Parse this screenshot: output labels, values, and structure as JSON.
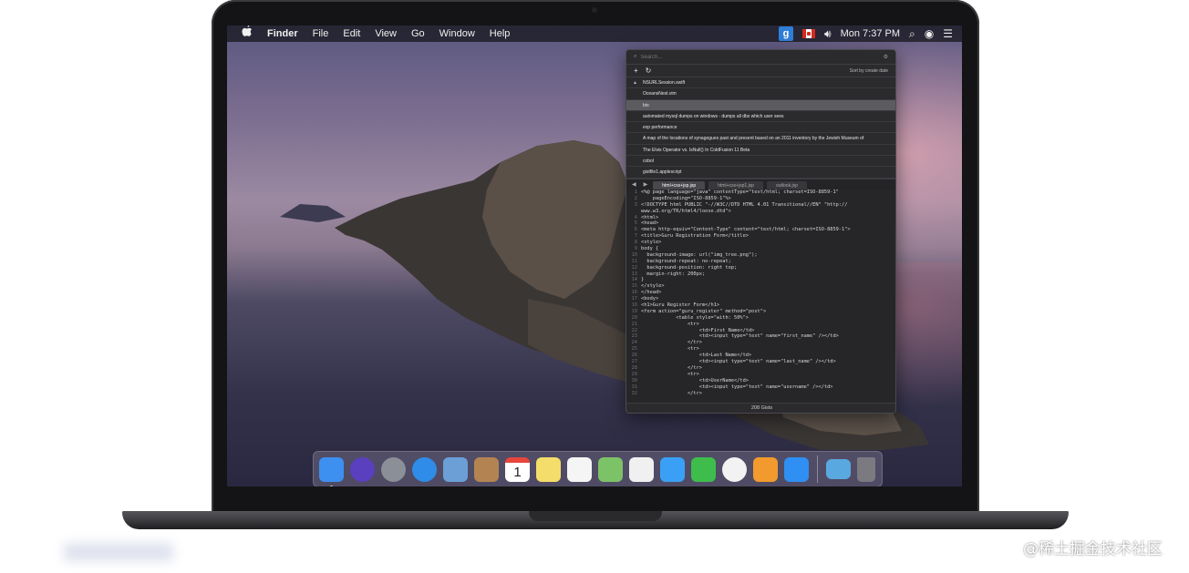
{
  "menubar": {
    "app_name": "Finder",
    "menus": [
      "File",
      "Edit",
      "View",
      "Go",
      "Window",
      "Help"
    ],
    "clock": "Mon 7:37 PM",
    "status_gist_letter": "g"
  },
  "popover": {
    "search_placeholder": "Search...",
    "sort_label": "Sort by create date",
    "add_symbol": "+",
    "refresh_symbol": "↻",
    "gists": [
      "NSURLSession.swift",
      "OceansNest.vim",
      "bio",
      "automated mysql dumps on windows - dumps all dbs which user sees",
      "exp performance",
      "A map of the locations of synagogues past and present based on an 2011 inventory by the Jewish Museum of",
      "The Elvis Operator vs. IsNull() In ColdFusion 11 Beta",
      "cobol",
      "gistfile1.applescript"
    ],
    "selected_index": 2,
    "tabs": [
      "html+css+jsp.jsp",
      "html+css+jsp1.jsp",
      "outlook.jsp"
    ],
    "active_tab": 0,
    "code_lines": [
      "<%@ page language=\"java\" contentType=\"text/html; charset=ISO-8859-1\"",
      "    pageEncoding=\"ISO-8859-1\"%>",
      "<!DOCTYPE html PUBLIC \"-//W3C//DTD HTML 4.01 Transitional//EN\" \"http://",
      "www.w3.org/TR/html4/loose.dtd\">",
      "<html>",
      "<head>",
      "<meta http-equiv=\"Content-Type\" content=\"text/html; charset=ISO-8859-1\">",
      "<title>Guru Registration Form</title>",
      "<style>",
      "body {",
      "  background-image: url(\"img_tree.png\");",
      "  background-repeat: no-repeat;",
      "  background-position: right top;",
      "  margin-right: 200px;",
      "}",
      "</style>",
      "</head>",
      "<body>",
      "<h1>Guru Register Form</h1>",
      "<form action=\"guru_register\" method=\"post\">",
      "            <table style=\"with: 50%\">",
      "                <tr>",
      "                    <td>First Name</td>",
      "                    <td><input type=\"text\" name=\"first_name\" /></td>",
      "                </tr>",
      "                <tr>",
      "                    <td>Last Name</td>",
      "                    <td><input type=\"text\" name=\"last_name\" /></td>",
      "                </tr>",
      "                <tr>",
      "                    <td>UserName</td>",
      "                    <td><input type=\"text\" name=\"username\" /></td>",
      "                </tr>"
    ],
    "line_numbers": [
      "1",
      "2",
      "3",
      "",
      "4",
      "5",
      "6",
      "7",
      "8",
      "9",
      "10",
      "11",
      "12",
      "13",
      "14",
      "15",
      "16",
      "17",
      "18",
      "19",
      "20",
      "21",
      "22",
      "23",
      "24",
      "25",
      "26",
      "27",
      "28",
      "29",
      "30",
      "31",
      "32"
    ],
    "footer": "208 Gists"
  },
  "dock": {
    "apps": [
      {
        "name": "finder-icon",
        "color": "#3d8ff0"
      },
      {
        "name": "siri-icon",
        "color": "#5a3fbf"
      },
      {
        "name": "launchpad-icon",
        "color": "#8a8f98"
      },
      {
        "name": "safari-icon",
        "color": "#2f8ce8"
      },
      {
        "name": "preview-icon",
        "color": "#6b9fd6"
      },
      {
        "name": "contacts-icon",
        "color": "#b38452"
      },
      {
        "name": "calendar-icon",
        "color": "#ffffff"
      },
      {
        "name": "notes-icon",
        "color": "#f5dd6b"
      },
      {
        "name": "reminders-icon",
        "color": "#f5f5f5"
      },
      {
        "name": "maps-icon",
        "color": "#7cc267"
      },
      {
        "name": "photos-icon",
        "color": "#f0f0f0"
      },
      {
        "name": "messages-icon",
        "color": "#3aa0f5"
      },
      {
        "name": "facetime-icon",
        "color": "#3ebd4d"
      },
      {
        "name": "news-icon",
        "color": "#f2f2f2"
      },
      {
        "name": "books-icon",
        "color": "#f29a2e"
      },
      {
        "name": "app-store-icon",
        "color": "#2f8ff2"
      }
    ],
    "calendar_day": "1",
    "folder_color": "#5aa8e0",
    "trash_color": "#7a7a80"
  },
  "watermark": "@稀土掘金技术社区"
}
